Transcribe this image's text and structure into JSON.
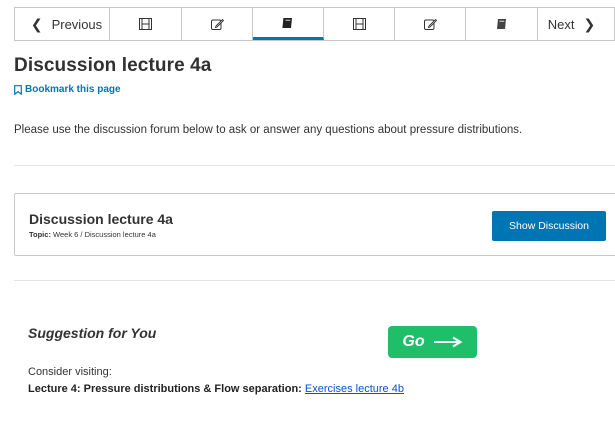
{
  "nav": {
    "previous_label": "Previous",
    "next_label": "Next",
    "units": [
      {
        "icon": "film-icon",
        "active": false
      },
      {
        "icon": "edit-icon",
        "active": false
      },
      {
        "icon": "book-icon",
        "active": true
      },
      {
        "icon": "film-icon",
        "active": false
      },
      {
        "icon": "edit-icon",
        "active": false
      },
      {
        "icon": "book-icon",
        "active": false
      }
    ]
  },
  "page": {
    "title": "Discussion lecture 4a",
    "bookmark_label": "Bookmark this page",
    "intro": "Please use the discussion forum below to ask or answer any questions about pressure distributions."
  },
  "discussion": {
    "title": "Discussion lecture 4a",
    "topic_label": "Topic:",
    "topic_value": "Week 6 / Discussion lecture 4a",
    "button_label": "Show Discussion"
  },
  "suggestion": {
    "title": "Suggestion for You",
    "go_label": "Go",
    "consider_text": "Consider visiting:",
    "lecture_text": "Lecture 4: Pressure distributions & Flow separation:",
    "link_text": "Exercises lecture 4b"
  },
  "colors": {
    "accent": "#0075b4",
    "go_green": "#1fbf6a",
    "link": "#0a4fd6"
  }
}
